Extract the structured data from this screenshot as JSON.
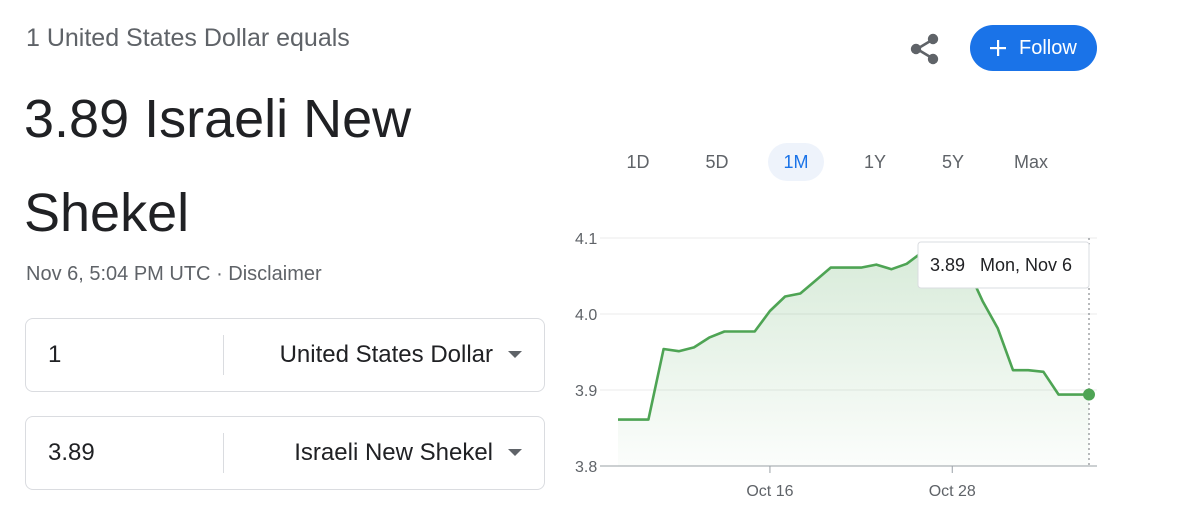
{
  "header": {
    "subtitle": "1 United States Dollar equals",
    "value": "3.89 Israeli New Shekel",
    "timestamp": "Nov 6, 5:04 PM UTC",
    "separator": " · ",
    "disclaimer": "Disclaimer"
  },
  "actions": {
    "share_icon": "share-icon",
    "follow_label": "Follow",
    "follow_color": "#1a73e8"
  },
  "converter": {
    "from": {
      "amount": "1",
      "currency": "United States Dollar"
    },
    "to": {
      "amount": "3.89",
      "currency": "Israeli New Shekel"
    }
  },
  "ranges": {
    "tabs": [
      "1D",
      "5D",
      "1M",
      "1Y",
      "5Y",
      "Max"
    ],
    "active": "1M"
  },
  "chart_data": {
    "type": "area",
    "line_color": "#4ea454",
    "ylim": [
      3.8,
      4.1
    ],
    "yticks": [
      "4.1",
      "4.0",
      "3.9",
      "3.8"
    ],
    "xticks": [
      "Oct 16",
      "Oct 28"
    ],
    "x": [
      "Oct 6",
      "Oct 7",
      "Oct 8",
      "Oct 9",
      "Oct 10",
      "Oct 11",
      "Oct 12",
      "Oct 13",
      "Oct 14",
      "Oct 15",
      "Oct 16",
      "Oct 17",
      "Oct 18",
      "Oct 19",
      "Oct 20",
      "Oct 21",
      "Oct 22",
      "Oct 23",
      "Oct 24",
      "Oct 25",
      "Oct 26",
      "Oct 27",
      "Oct 28",
      "Oct 29",
      "Oct 30",
      "Oct 31",
      "Nov 1",
      "Nov 2",
      "Nov 3",
      "Nov 4",
      "Nov 5",
      "Nov 6"
    ],
    "values": [
      3.861,
      3.861,
      3.861,
      3.954,
      3.951,
      3.956,
      3.969,
      3.977,
      3.977,
      3.977,
      4.004,
      4.023,
      4.027,
      4.044,
      4.061,
      4.061,
      4.061,
      4.065,
      4.059,
      4.066,
      4.081,
      4.084,
      4.08,
      4.06,
      4.017,
      3.981,
      3.926,
      3.926,
      3.924,
      3.894,
      3.894,
      3.894
    ],
    "tooltip": {
      "value": "3.89",
      "date": "Mon, Nov 6"
    }
  }
}
